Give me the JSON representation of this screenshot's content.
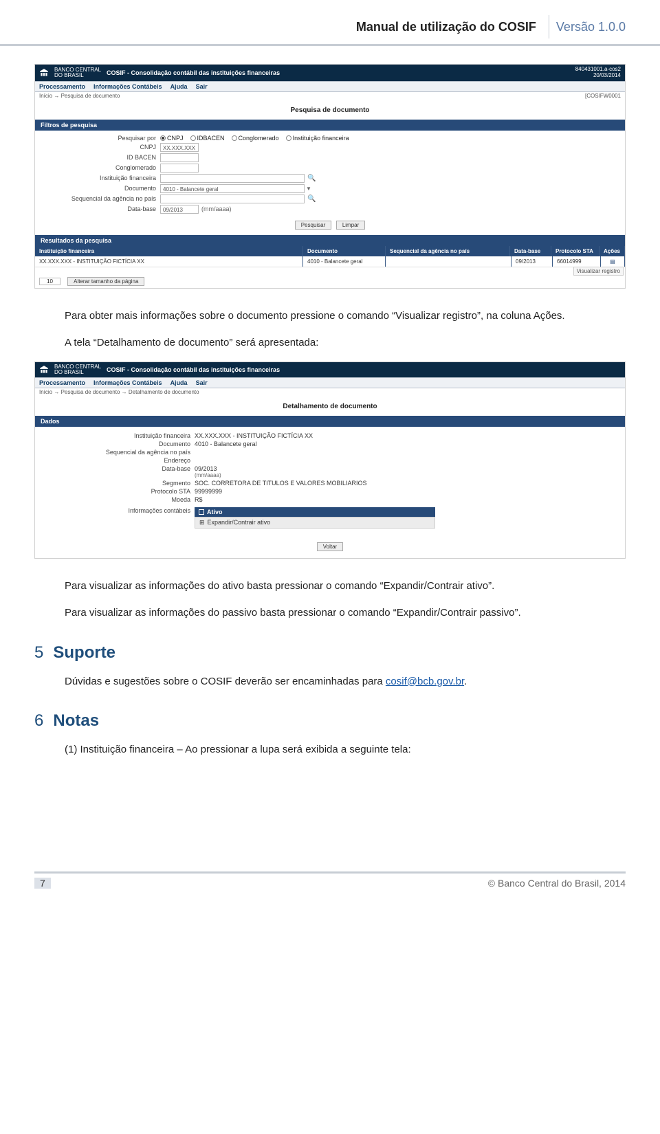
{
  "header": {
    "title": "Manual de utilização do COSIF",
    "version": "Versão 1.0.0"
  },
  "ss_common": {
    "brand_l1": "BANCO CENTRAL",
    "brand_l2": "DO BRASIL",
    "app_name": "COSIF - Consolidação contábil das instituições financeiras",
    "top_right_l1": "840431001.a-cos2",
    "top_right_l2": "20/03/2014",
    "menu": {
      "m0": "Processamento",
      "m1": "Informações Contábeis",
      "m2": "Ajuda",
      "m3": "Sair"
    }
  },
  "ss1": {
    "breadcrumb": "Início → Pesquisa de documento",
    "sysid": "[COSIFW0001",
    "page_title": "Pesquisa de documento",
    "section_filters": "Filtros de pesquisa",
    "labels": {
      "pesq_por": "Pesquisar por",
      "cnpj": "CNPJ",
      "idbacen": "ID BACEN",
      "cong": "Conglomerado",
      "instfin": "Instituição financeira",
      "doc": "Documento",
      "seq": "Sequencial da agência no país",
      "database": "Data-base"
    },
    "radios": {
      "r0": "CNPJ",
      "r1": "IDBACEN",
      "r2": "Conglomerado",
      "r3": "Instituição financeira"
    },
    "cnpj_val": "XX.XXX.XXX",
    "doc_val": "4010 - Balancete geral",
    "database_val": "09/2013",
    "database_hint": "(mm/aaaa)",
    "btn_pesq": "Pesquisar",
    "btn_limpar": "Limpar",
    "section_results": "Resultados da pesquisa",
    "cols": {
      "inst": "Instituição financeira",
      "doc": "Documento",
      "seq": "Sequencial da agência no país",
      "db": "Data-base",
      "prot": "Protocolo STA",
      "ac": "Ações"
    },
    "row": {
      "inst": "XX.XXX.XXX - INSTITUIÇÃO FICTÍCIA XX",
      "doc": "4010 - Balancete geral",
      "seq": "",
      "db": "09/2013",
      "prot": "66014999",
      "ac": "▤"
    },
    "pager_n": "10",
    "pager_btn": "Alterar tamanho da página",
    "float_btn": "Visualizar registro"
  },
  "para1": "Para obter mais informações sobre o documento pressione o comando “Visualizar registro”, na coluna Ações.",
  "para2": "A tela “Detalhamento de documento” será apresentada:",
  "ss2": {
    "breadcrumb": "Início → Pesquisa de documento → Detalhamento de documento",
    "page_title": "Detalhamento de documento",
    "section_dados": "Dados",
    "labels": {
      "inst": "Instituição financeira",
      "doc": "Documento",
      "seq": "Sequencial da agência no país",
      "end": "Endereço",
      "db": "Data-base",
      "seg": "Segmento",
      "prot": "Protocolo STA",
      "moeda": "Moeda",
      "info": "Informações contábeis"
    },
    "vals": {
      "inst": "XX.XXX.XXX - INSTITUIÇÃO FICTÍCIA XX",
      "doc": "4010 - Balancete geral",
      "db_l1": "09/2013",
      "db_l2": "(mm/aaaa)",
      "seg": "SOC. CORRETORA DE TITULOS E VALORES MOBILIARIOS",
      "prot": "99999999",
      "moeda": "R$"
    },
    "info_head": "Ativo",
    "info_row": "Expandir/Contrair ativo",
    "btn_voltar": "Voltar"
  },
  "para3": "Para visualizar as informações do ativo basta pressionar o comando “Expandir/Contrair ativo”.",
  "para4": "Para visualizar as informações do passivo basta pressionar o comando “Expandir/Contrair passivo”.",
  "sec5": {
    "num": "5",
    "title": "Suporte"
  },
  "para5_a": "Dúvidas e sugestões sobre o COSIF deverão ser encaminhadas para ",
  "para5_link": "cosif@bcb.gov.br",
  "para5_b": ".",
  "sec6": {
    "num": "6",
    "title": "Notas"
  },
  "note1": "(1) Instituição financeira – Ao pressionar a lupa será exibida a seguinte tela:",
  "footer": {
    "page": "7",
    "copyright": "© Banco Central do Brasil, 2014"
  }
}
